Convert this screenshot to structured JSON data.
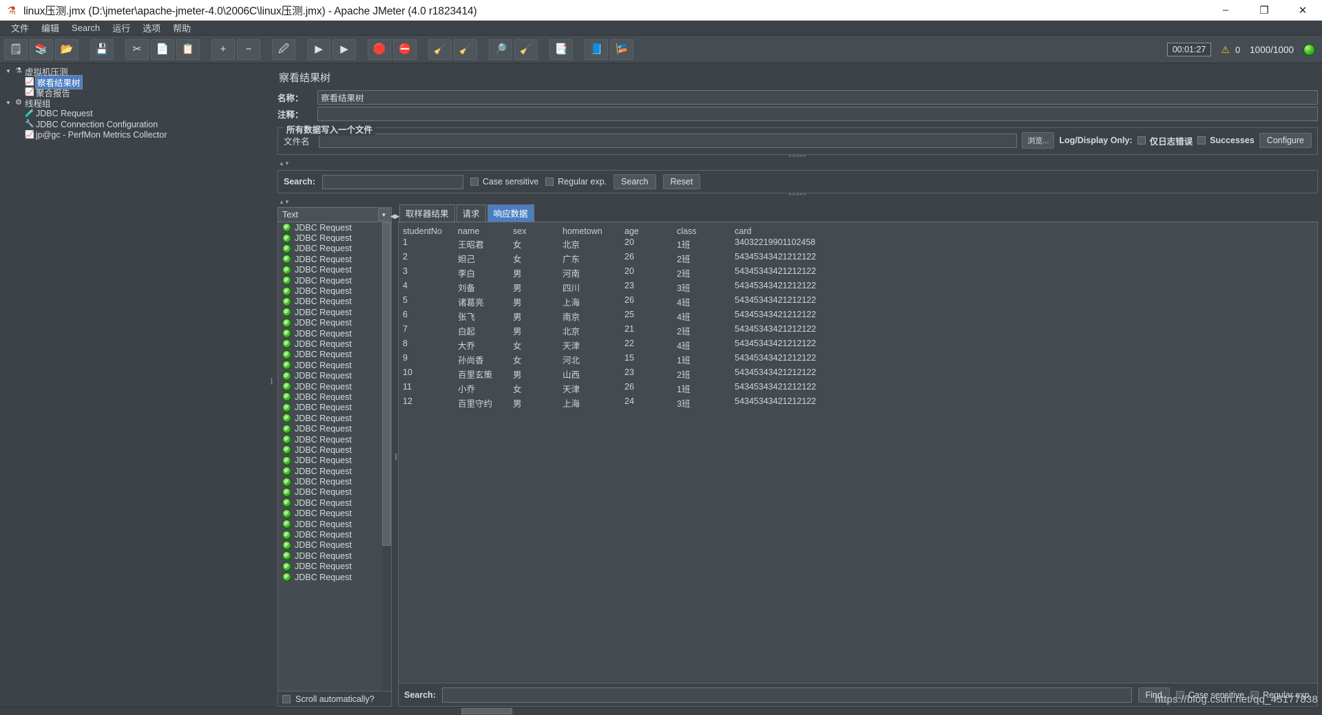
{
  "window": {
    "title": "linux压测.jmx (D:\\jmeter\\apache-jmeter-4.0\\2006C\\linux压测.jmx) - Apache JMeter (4.0 r1823414)",
    "app_icon": "jmeter-flask-icon",
    "minimize": "–",
    "maximize": "❐",
    "close": "✕"
  },
  "menubar": {
    "items": [
      {
        "label": "文件",
        "name": "menu-file"
      },
      {
        "label": "编辑",
        "name": "menu-edit"
      },
      {
        "label": "Search",
        "name": "menu-search"
      },
      {
        "label": "运行",
        "name": "menu-run"
      },
      {
        "label": "选项",
        "name": "menu-options"
      },
      {
        "label": "帮助",
        "name": "menu-help"
      }
    ]
  },
  "toolbar": {
    "buttons": [
      {
        "name": "new-test-plan-button",
        "glyph": "🗒"
      },
      {
        "name": "templates-button",
        "glyph": "📚"
      },
      {
        "name": "open-button",
        "glyph": "📂"
      },
      {
        "name": "save-button",
        "glyph": "💾"
      },
      {
        "name": "cut-button",
        "glyph": "✂"
      },
      {
        "name": "copy-button",
        "glyph": "📄"
      },
      {
        "name": "paste-button",
        "glyph": "📋"
      },
      {
        "name": "expand-all-button",
        "glyph": "+"
      },
      {
        "name": "collapse-all-button",
        "glyph": "−"
      },
      {
        "name": "toggle-button",
        "glyph": "🖉"
      },
      {
        "name": "start-button",
        "glyph": "▶"
      },
      {
        "name": "start-no-timers-button",
        "glyph": "▶"
      },
      {
        "name": "stop-button",
        "glyph": "🛑"
      },
      {
        "name": "shutdown-button",
        "glyph": "⛔"
      },
      {
        "name": "clear-button",
        "glyph": "🧹"
      },
      {
        "name": "clear-all-button",
        "glyph": "🧹"
      },
      {
        "name": "search-button",
        "glyph": "🔎"
      },
      {
        "name": "reset-search-button",
        "glyph": "🧹"
      },
      {
        "name": "function-helper-button",
        "glyph": "📑"
      },
      {
        "name": "help-button",
        "glyph": "📘"
      },
      {
        "name": "undo-button",
        "glyph": "🎏"
      }
    ],
    "status": {
      "elapsed": "00:01:27",
      "warning_icon": "warning-triangle-icon",
      "warning_count": "0",
      "threads": "1000/1000",
      "running_indicator": "green-orb-icon"
    }
  },
  "tree": {
    "items": [
      {
        "label": "虚拟机压测",
        "level": 0,
        "twisty": "▼",
        "icon": "test-plan-icon",
        "selected": false,
        "name": "tree-item-test-plan"
      },
      {
        "label": "察看结果树",
        "level": 1,
        "twisty": "",
        "icon": "view-results-tree-icon",
        "selected": true,
        "name": "tree-item-view-results-tree"
      },
      {
        "label": "聚合报告",
        "level": 1,
        "twisty": "",
        "icon": "aggregate-report-icon",
        "selected": false,
        "name": "tree-item-aggregate-report"
      },
      {
        "label": "线程组",
        "level": 0,
        "twisty": "▼",
        "icon": "thread-group-icon",
        "selected": false,
        "name": "tree-item-thread-group"
      },
      {
        "label": "JDBC Request",
        "level": 1,
        "twisty": "",
        "icon": "jdbc-request-icon",
        "selected": false,
        "name": "tree-item-jdbc-request"
      },
      {
        "label": "JDBC Connection Configuration",
        "level": 1,
        "twisty": "",
        "icon": "jdbc-connection-config-icon",
        "selected": false,
        "name": "tree-item-jdbc-connection-configuration"
      },
      {
        "label": "jp@gc - PerfMon Metrics Collector",
        "level": 1,
        "twisty": "",
        "icon": "perfmon-collector-icon",
        "selected": false,
        "name": "tree-item-perfmon-metrics-collector"
      }
    ]
  },
  "panel": {
    "title": "察看结果树",
    "name_label": "名称：",
    "name_value": "察看结果树",
    "comment_label": "注释：",
    "comment_value": "",
    "filegroup": {
      "title": "所有数据写入一个文件",
      "filename_label": "文件名",
      "filename_value": "",
      "browse_button": "浏览...",
      "log_display_only_label": "Log/Display Only:",
      "errors_only_label": "仅日志错误",
      "successes_label": "Successes",
      "configure_button": "Configure"
    },
    "search": {
      "label": "Search:",
      "value": "",
      "case_sensitive_label": "Case sensitive",
      "regular_exp_label": "Regular exp.",
      "search_button": "Search",
      "reset_button": "Reset"
    },
    "renderer": {
      "selected": "Text",
      "arrow_icon": "chevron-down-icon"
    },
    "results_list": {
      "row_label": "JDBC Request",
      "row_icon": "success-check-icon",
      "row_count": 34,
      "scroll_auto_label": "Scroll automatically?"
    },
    "tabs": [
      {
        "label": "取样器结果",
        "active": false,
        "name": "tab-sampler-result"
      },
      {
        "label": "请求",
        "active": false,
        "name": "tab-request"
      },
      {
        "label": "响应数据",
        "active": true,
        "name": "tab-response-data"
      }
    ],
    "response_table": {
      "headers": [
        "studentNo",
        "name",
        "sex",
        "hometown",
        "age",
        "class",
        "card"
      ],
      "rows": [
        [
          "1",
          "王昭君",
          "女",
          "北京",
          "20",
          "1班",
          "34032219901102458"
        ],
        [
          "2",
          "妲己",
          "女",
          "广东",
          "26",
          "2班",
          "54345343421212122"
        ],
        [
          "3",
          "李白",
          "男",
          "河南",
          "20",
          "2班",
          "54345343421212122"
        ],
        [
          "4",
          "刘备",
          "男",
          "四川",
          "23",
          "3班",
          "54345343421212122"
        ],
        [
          "5",
          "诸葛亮",
          "男",
          "上海",
          "26",
          "4班",
          "54345343421212122"
        ],
        [
          "6",
          "张飞",
          "男",
          "南京",
          "25",
          "4班",
          "54345343421212122"
        ],
        [
          "7",
          "白起",
          "男",
          "北京",
          "21",
          "2班",
          "54345343421212122"
        ],
        [
          "8",
          "大乔",
          "女",
          "天津",
          "22",
          "4班",
          "54345343421212122"
        ],
        [
          "9",
          "孙尚香",
          "女",
          "河北",
          "15",
          "1班",
          "54345343421212122"
        ],
        [
          "10",
          "百里玄策",
          "男",
          "山西",
          "23",
          "2班",
          "54345343421212122"
        ],
        [
          "11",
          "小乔",
          "女",
          "天津",
          "26",
          "1班",
          "54345343421212122"
        ],
        [
          "12",
          "百里守约",
          "男",
          "上海",
          "24",
          "3班",
          "54345343421212122"
        ]
      ]
    },
    "detail_search": {
      "label": "Search:",
      "value": "",
      "find_button": "Find",
      "case_sensitive_label": "Case sensitive",
      "regular_exp_label": "Regular exp."
    }
  },
  "watermark": "https://blog.csdn.net/qq_45177838"
}
